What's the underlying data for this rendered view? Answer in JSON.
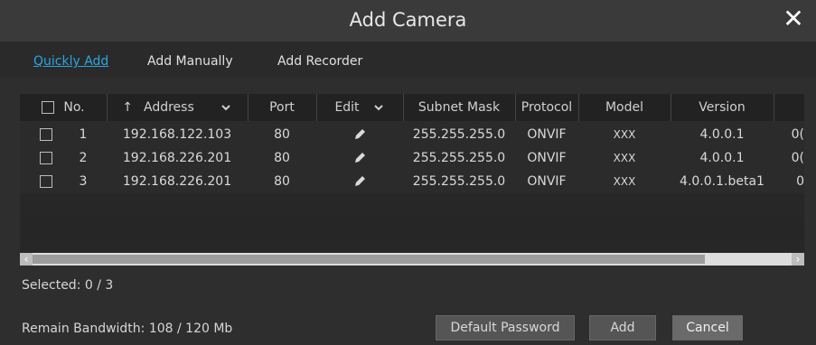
{
  "dialog": {
    "title": "Add Camera",
    "tabs": [
      {
        "label": "Quickly Add"
      },
      {
        "label": "Add Manually"
      },
      {
        "label": "Add Recorder"
      }
    ],
    "table": {
      "columns": {
        "no": "No.",
        "address": "Address",
        "port": "Port",
        "edit": "Edit",
        "subnet_mask": "Subnet Mask",
        "protocol": "Protocol",
        "model": "Model",
        "version": "Version"
      },
      "sort_indicator": "↑",
      "rows": [
        {
          "no": "1",
          "address": "192.168.122.103",
          "port": "80",
          "subnet_mask": "255.255.255.0",
          "protocol": "ONVIF",
          "model": "XXX",
          "version": "4.0.0.1",
          "extra": "0("
        },
        {
          "no": "2",
          "address": "192.168.226.201",
          "port": "80",
          "subnet_mask": "255.255.255.0",
          "protocol": "ONVIF",
          "model": "XXX",
          "version": "4.0.0.1",
          "extra": "0("
        },
        {
          "no": "3",
          "address": "192.168.226.201",
          "port": "80",
          "subnet_mask": "255.255.255.0",
          "protocol": "ONVIF",
          "model": "XXX",
          "version": "4.0.0.1.beta1",
          "extra": "0"
        }
      ]
    },
    "selected": "Selected: 0 / 3",
    "bandwidth": "Remain Bandwidth: 108 / 120 Mb",
    "buttons": {
      "default_password": "Default Password",
      "add": "Add",
      "cancel": "Cancel"
    },
    "icons": {
      "close": "close-icon",
      "pencil": "pencil-icon",
      "chevron": "chevron-down-icon"
    }
  }
}
